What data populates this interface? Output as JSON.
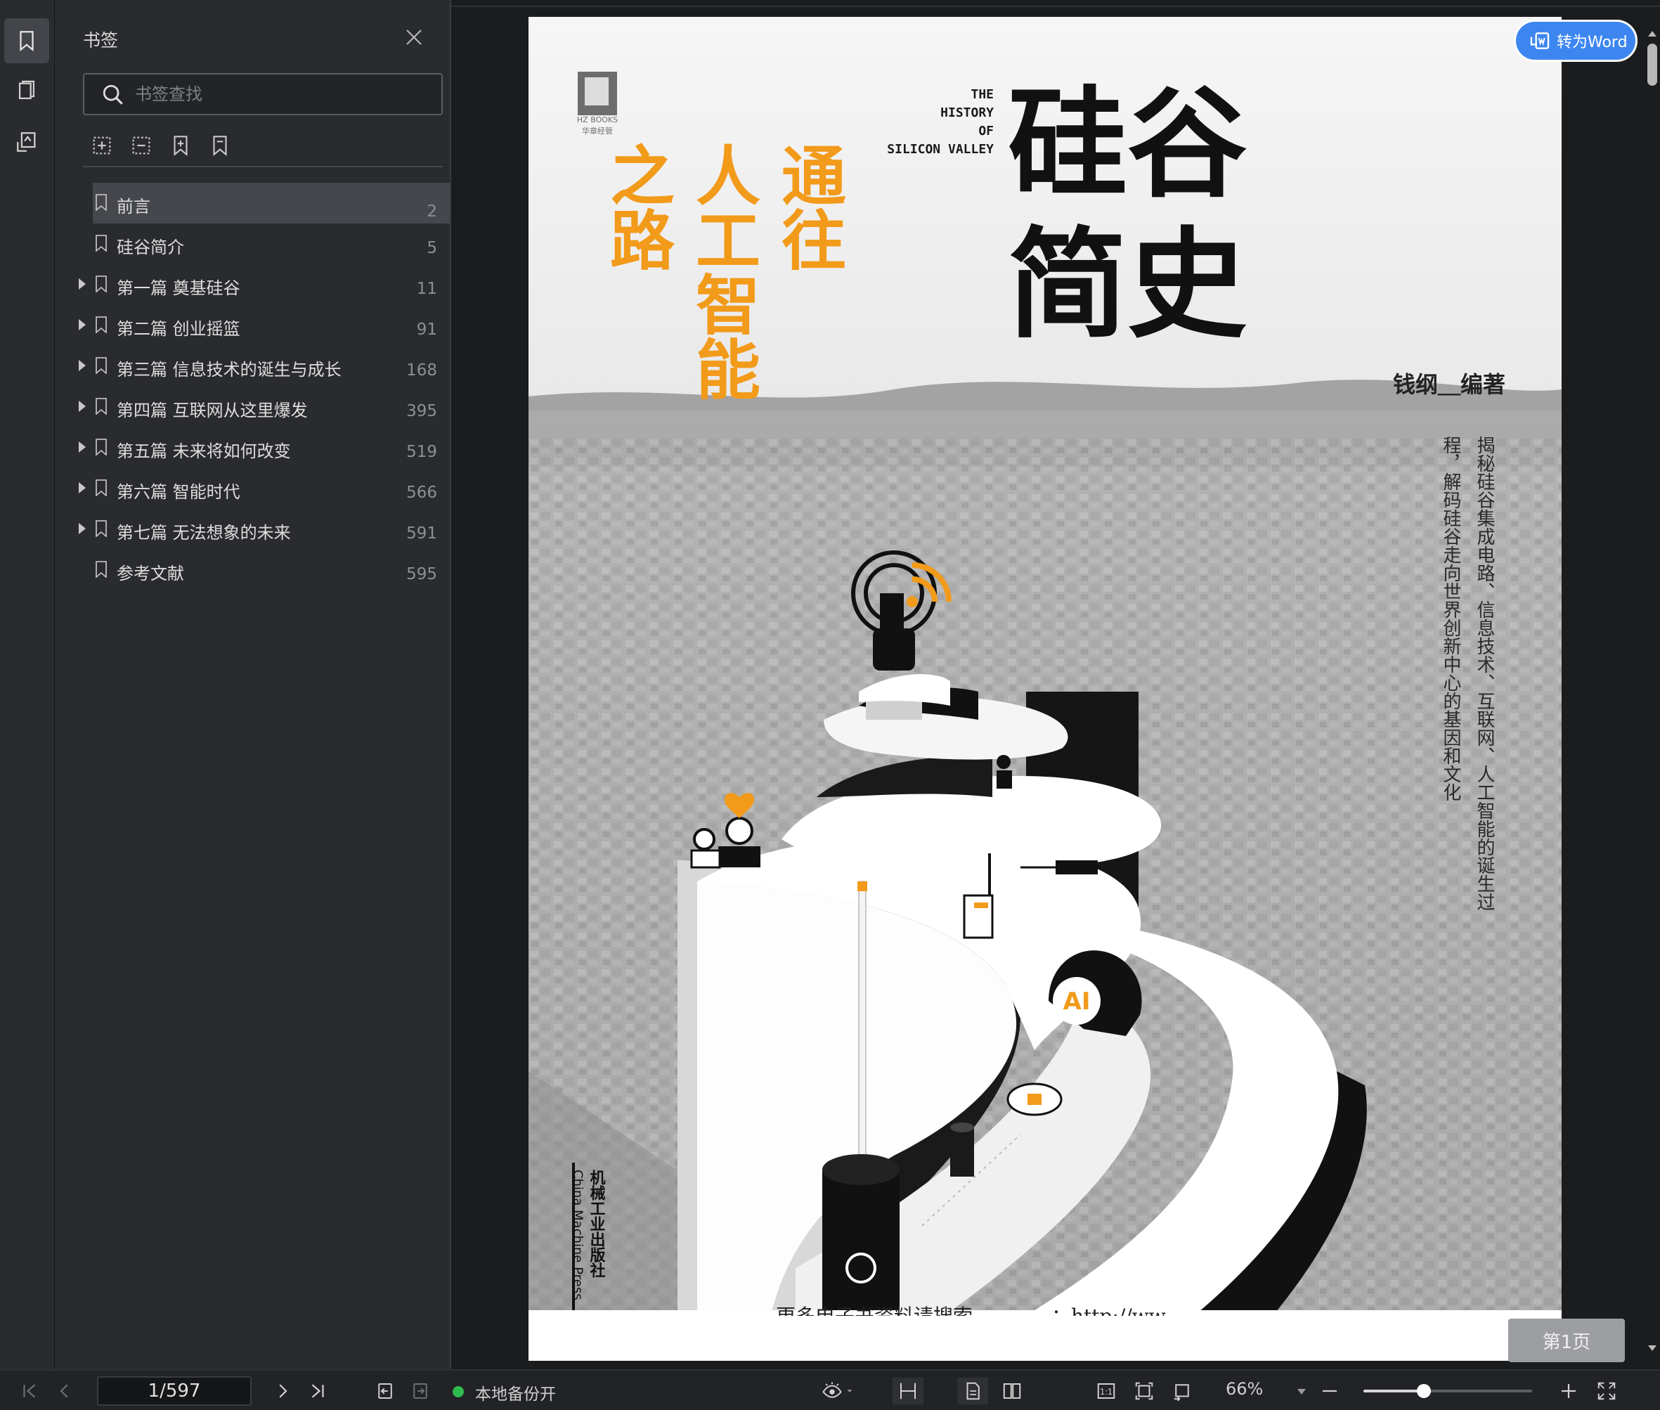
{
  "panel": {
    "title": "书签",
    "search_placeholder": "书签查找"
  },
  "bookmarks": [
    {
      "label": "前言",
      "page": "2",
      "expandable": false,
      "selected": true
    },
    {
      "label": "硅谷简介",
      "page": "5",
      "expandable": false
    },
    {
      "label": "第一篇 奠基硅谷",
      "page": "11",
      "expandable": true
    },
    {
      "label": "第二篇 创业摇篮",
      "page": "91",
      "expandable": true
    },
    {
      "label": "第三篇 信息技术的诞生与成长",
      "page": "168",
      "expandable": true
    },
    {
      "label": "第四篇 互联网从这里爆发",
      "page": "395",
      "expandable": true
    },
    {
      "label": "第五篇 未来将如何改变",
      "page": "519",
      "expandable": true
    },
    {
      "label": "第六篇 智能时代",
      "page": "566",
      "expandable": true
    },
    {
      "label": "第七篇 无法想象的未来",
      "page": "591",
      "expandable": true
    },
    {
      "label": "参考文献",
      "page": "595",
      "expandable": false
    }
  ],
  "cover": {
    "title_line1": "硅谷",
    "title_line2": "简史",
    "subtitle_col1": "通往",
    "subtitle_col2": "人工智能",
    "subtitle_col3": "之路",
    "english_lines": [
      "THE",
      "HISTORY",
      "OF",
      "SILICON VALLEY"
    ],
    "author": "钱纲＿编著",
    "tagline_col1": "揭秘硅谷集成电路、信息技术、互联网、人工智能的诞生过",
    "tagline_col2": "程，解码硅谷走向世界创新中心的基因和文化",
    "publisher_cn": "机械工业出版社",
    "publisher_en": "China Machine Press",
    "logo_text": "HZ BOOKS",
    "logo_sub": "华章经管",
    "ai_badge": "AI",
    "bottom_cut_text": "更多电子书资料请搜索…………：http://ww"
  },
  "toolbar": {
    "to_word_label": "转为Word",
    "page_badge": "第1页"
  },
  "status": {
    "page_value": "1/597",
    "backup_label": "本地备份开",
    "zoom_label": "66%",
    "zoom_fraction": 0.36
  },
  "colors": {
    "accent_orange": "#f29a1a",
    "word_blue": "#3d86f0",
    "backup_green": "#2dbb4e"
  }
}
